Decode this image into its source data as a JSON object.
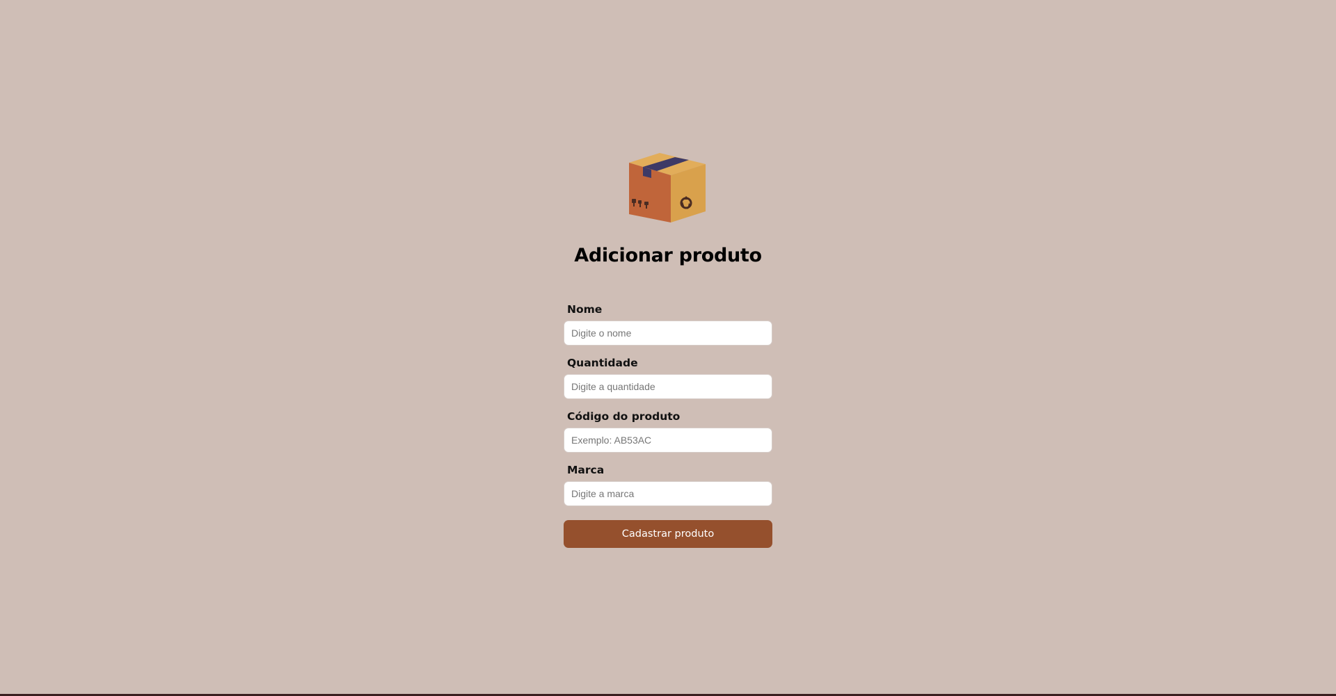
{
  "page": {
    "title": "Adicionar produto",
    "logo_icon": "cardboard-box-icon",
    "background_color": "#cfbeb6",
    "accent_color": "#95502d"
  },
  "form": {
    "fields": [
      {
        "label": "Nome",
        "placeholder": "Digite o nome",
        "value": ""
      },
      {
        "label": "Quantidade",
        "placeholder": "Digite a quantidade",
        "value": ""
      },
      {
        "label": "Código do produto",
        "placeholder": "Exemplo: AB53AC",
        "value": ""
      },
      {
        "label": "Marca",
        "placeholder": "Digite a marca",
        "value": ""
      }
    ],
    "submit_label": "Cadastrar produto"
  }
}
